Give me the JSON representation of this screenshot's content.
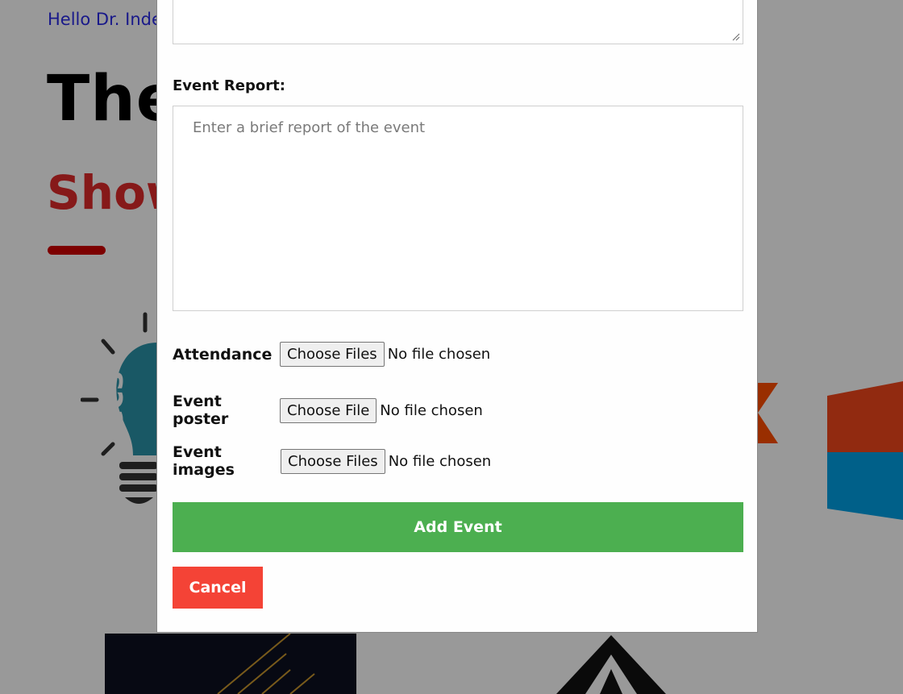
{
  "background": {
    "greeting": "Hello Dr. Inde",
    "title": "The",
    "subtitle": "Show",
    "accent_color": "#d10000"
  },
  "modal": {
    "report": {
      "label": "Event Report:",
      "placeholder": "Enter a brief report of the event"
    },
    "uploads": [
      {
        "label": "Attendance",
        "button": "Choose Files",
        "status": "No file chosen"
      },
      {
        "label": "Event poster",
        "button": "Choose File",
        "status": "No file chosen"
      },
      {
        "label": "Event images",
        "button": "Choose Files",
        "status": "No file chosen"
      }
    ],
    "add_button": "Add Event",
    "cancel_button": "Cancel",
    "colors": {
      "add": "#4caf50",
      "cancel": "#f44336"
    }
  }
}
